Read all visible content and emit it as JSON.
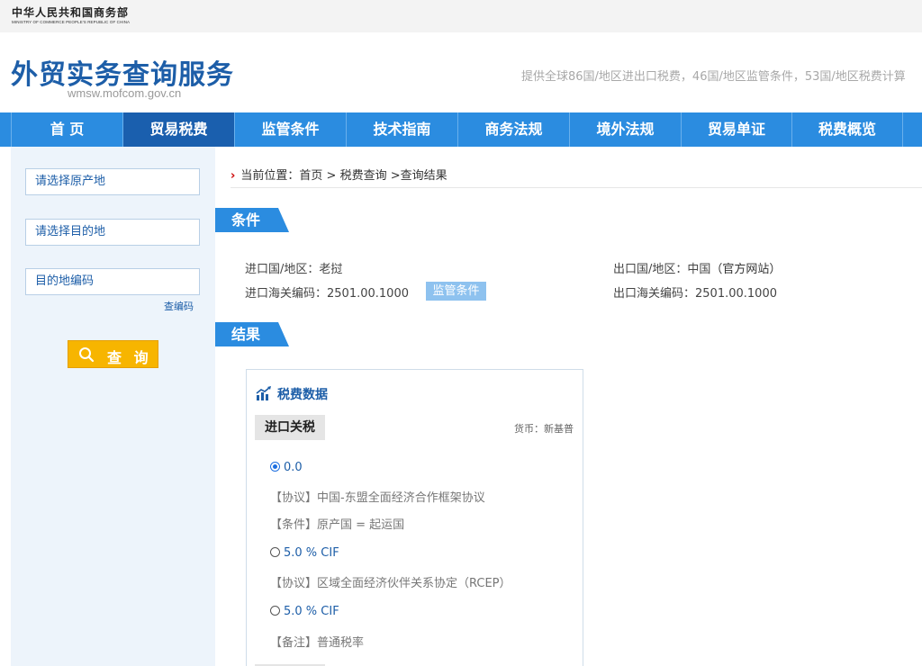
{
  "ministry": {
    "name_cn": "中华人民共和国商务部",
    "name_en": "MINISTRY OF COMMERCE PEOPLE'S REPUBLIC OF CHINA"
  },
  "header": {
    "title": "外贸实务查询服务",
    "domain": "wmsw.mofcom.gov.cn",
    "tagline": "提供全球86国/地区进出口税费，46国/地区监管条件，53国/地区税费计算"
  },
  "nav": {
    "items": [
      {
        "label": "首 页"
      },
      {
        "label": "贸易税费"
      },
      {
        "label": "监管条件"
      },
      {
        "label": "技术指南"
      },
      {
        "label": "商务法规"
      },
      {
        "label": "境外法规"
      },
      {
        "label": "贸易单证"
      },
      {
        "label": "税费概览"
      }
    ],
    "active_index": 1
  },
  "sidebar": {
    "origin_placeholder": "请选择原产地",
    "destination_placeholder": "请选择目的地",
    "code_placeholder": "目的地编码",
    "code_lookup_link": "查编码",
    "query_button": "查 询"
  },
  "breadcrumb": {
    "prefix": "当前位置：",
    "home": "首页",
    "sep1": " > ",
    "tax_query": "税费查询",
    "sep2": " >",
    "current": "查询结果"
  },
  "conditions": {
    "section_title": "条件",
    "import_country_label": "进口国/地区：",
    "import_country": "老挝",
    "import_code_label": "进口海关编码：",
    "import_code": "2501.00.1000",
    "supervise_badge": "监管条件",
    "export_country_label": "出口国/地区：",
    "export_country": "中国",
    "official_site": "（官方网站）",
    "export_code_label": "出口海关编码：",
    "export_code": "2501.00.1000"
  },
  "results": {
    "section_title": "结果",
    "card_title": "税费数据",
    "tab_label": "进口关税",
    "currency": "货币：新基普",
    "options": [
      {
        "rate": "0.0",
        "selected": true,
        "notes": [
          "【协议】中国-东盟全面经济合作框架协议",
          "【条件】原产国 = 起运国"
        ]
      },
      {
        "rate": "5.0 % CIF",
        "selected": false,
        "notes": [
          "【协议】区域全面经济伙伴关系协定（RCEP）"
        ]
      },
      {
        "rate": "5.0 % CIF",
        "selected": false,
        "notes": [
          "【备注】普通税率"
        ]
      }
    ]
  },
  "colors": {
    "nav_blue": "#2b8ce0",
    "nav_active": "#1a5fae",
    "title_blue": "#1d5ea8",
    "query_yellow": "#f7b500"
  }
}
